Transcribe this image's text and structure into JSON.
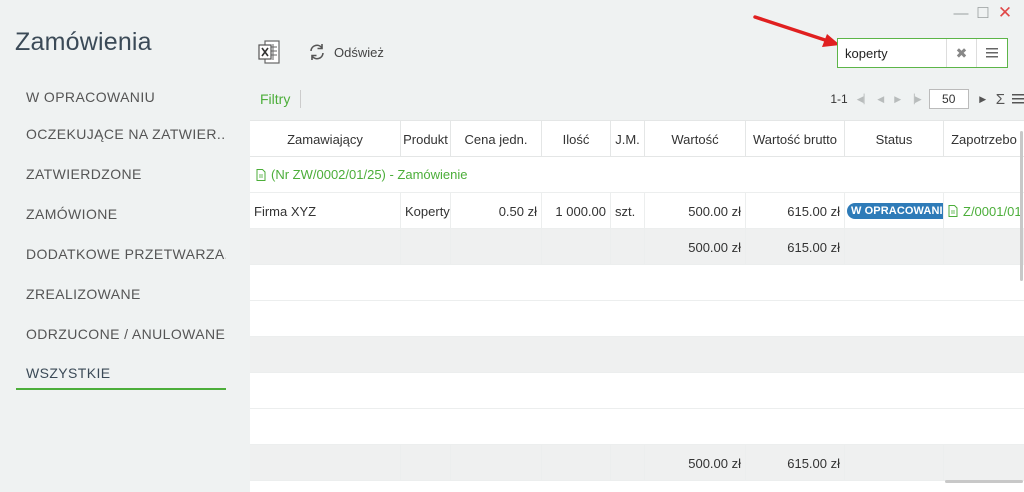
{
  "window": {
    "minimize": "—",
    "maximize": "☐",
    "close": "✕"
  },
  "page_title": "Zamówienia",
  "sidebar": {
    "items": [
      {
        "label": "W OPRACOWANIU"
      },
      {
        "label": "OCZEKUJĄCE NA ZATWIER..."
      },
      {
        "label": "ZATWIERDZONE"
      },
      {
        "label": "ZAMÓWIONE"
      },
      {
        "label": "DODATKOWE PRZETWARZA..."
      },
      {
        "label": "ZREALIZOWANE"
      },
      {
        "label": "ODRZUCONE / ANULOWANE"
      },
      {
        "label": "WSZYSTKIE"
      }
    ],
    "active_index": 7
  },
  "toolbar": {
    "excel_icon": "excel-export-icon",
    "refresh_label": "Odśwież"
  },
  "search": {
    "value": "koperty",
    "clear": "✖"
  },
  "filters": {
    "label": "Filtry"
  },
  "pager": {
    "range": "1-1",
    "page_size": "50",
    "sum": "Σ"
  },
  "grid": {
    "columns": [
      "Zamawiający",
      "Produkt",
      "Cena jedn.",
      "Ilość",
      "J.M.",
      "Wartość",
      "Wartość brutto",
      "Status",
      "Zapotrzebo"
    ],
    "group_label": "(Nr ZW/0002/01/25) - Zamówienie",
    "row": {
      "ordering": "Firma XYZ",
      "product": "Koperty",
      "unit_price": "0.50 zł",
      "quantity": "1 000.00",
      "unit": "szt.",
      "value": "500.00 zł",
      "gross": "615.00 zł",
      "status": "W OPRACOWANIU",
      "requisition": "Z/0001/01"
    },
    "group_total": {
      "value": "500.00 zł",
      "gross": "615.00 zł"
    },
    "grand_total": {
      "value": "500.00 zł",
      "gross": "615.00 zł"
    }
  },
  "colors": {
    "accent": "#4cae3a",
    "status": "#2e7bb8",
    "annotation": "#e02020"
  }
}
